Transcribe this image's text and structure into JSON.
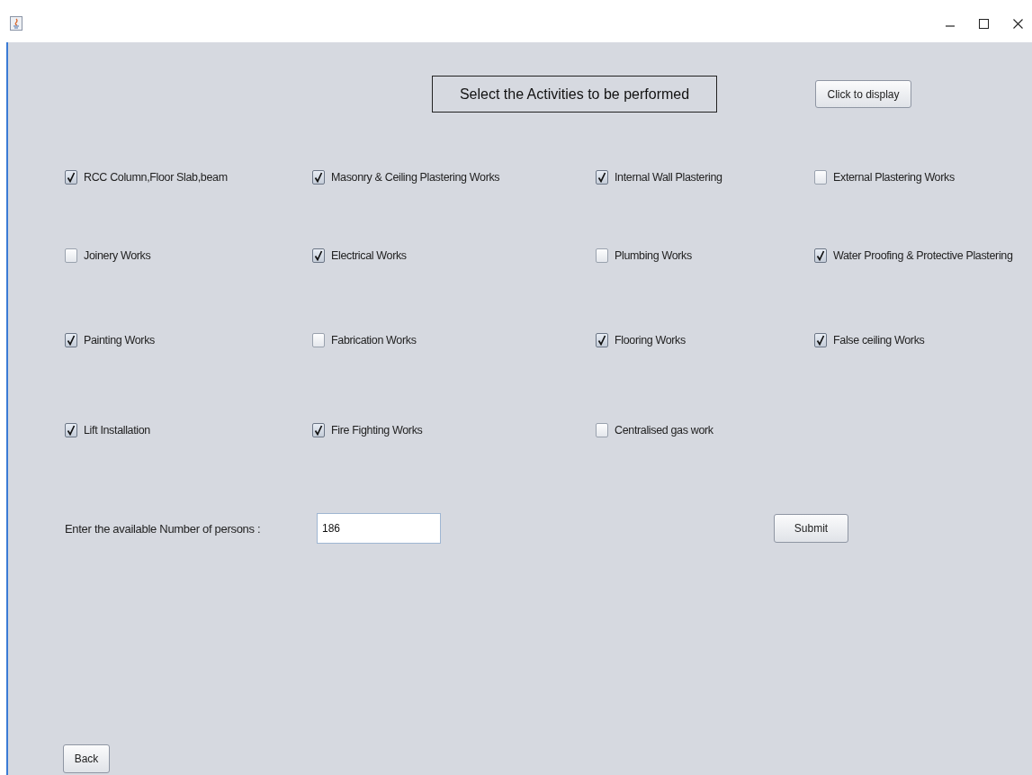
{
  "heading": "Select the Activities to be performed",
  "display_button": "Click to display",
  "activities": [
    {
      "label": "RCC Column,Floor Slab,beam",
      "checked": true
    },
    {
      "label": "Masonry & Ceiling Plastering Works",
      "checked": true
    },
    {
      "label": "Internal Wall Plastering",
      "checked": true
    },
    {
      "label": "External Plastering Works",
      "checked": false
    },
    {
      "label": "Joinery Works",
      "checked": false
    },
    {
      "label": "Electrical Works",
      "checked": true
    },
    {
      "label": "Plumbing Works",
      "checked": false
    },
    {
      "label": "Water Proofing & Protective Plastering",
      "checked": true
    },
    {
      "label": "Painting Works",
      "checked": true
    },
    {
      "label": "Fabrication Works",
      "checked": false
    },
    {
      "label": "Flooring Works",
      "checked": true
    },
    {
      "label": "False ceiling Works",
      "checked": true
    },
    {
      "label": "Lift Installation",
      "checked": true
    },
    {
      "label": "Fire Fighting Works",
      "checked": true
    },
    {
      "label": "Centralised gas work",
      "checked": false
    }
  ],
  "persons": {
    "label": "Enter the available Number of persons  :",
    "value": "186"
  },
  "submit_button": "Submit",
  "back_button": "Back"
}
